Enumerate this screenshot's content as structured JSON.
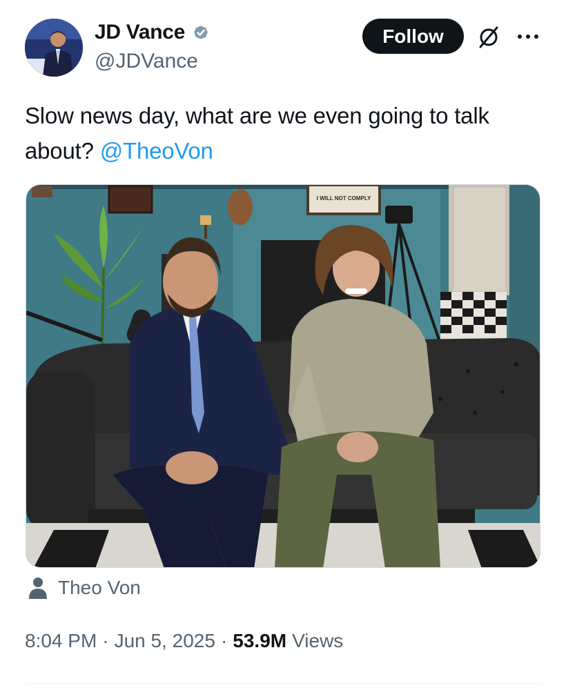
{
  "author": {
    "display_name": "JD Vance",
    "handle": "@JDVance",
    "verified_icon": "verified-badge-icon",
    "verified_color": "#829aab"
  },
  "actions": {
    "follow_label": "Follow",
    "grok_icon": "grok-icon",
    "more_icon": "more-options-icon"
  },
  "tweet": {
    "text": "Slow news day, what are we even going to talk about?",
    "mention": "@TheoVon"
  },
  "media": {
    "sign_text": "I WILL NOT COMPLY"
  },
  "tagged": {
    "icon": "person-icon",
    "name": "Theo Von"
  },
  "meta": {
    "time": "8:04 PM",
    "separator": "·",
    "date": "Jun 5, 2025",
    "views_count": "53.9M",
    "views_label": "Views"
  },
  "colors": {
    "text": "#0f1419",
    "secondary": "#536471",
    "link": "#1d9bf0",
    "button": "#0f1419"
  }
}
